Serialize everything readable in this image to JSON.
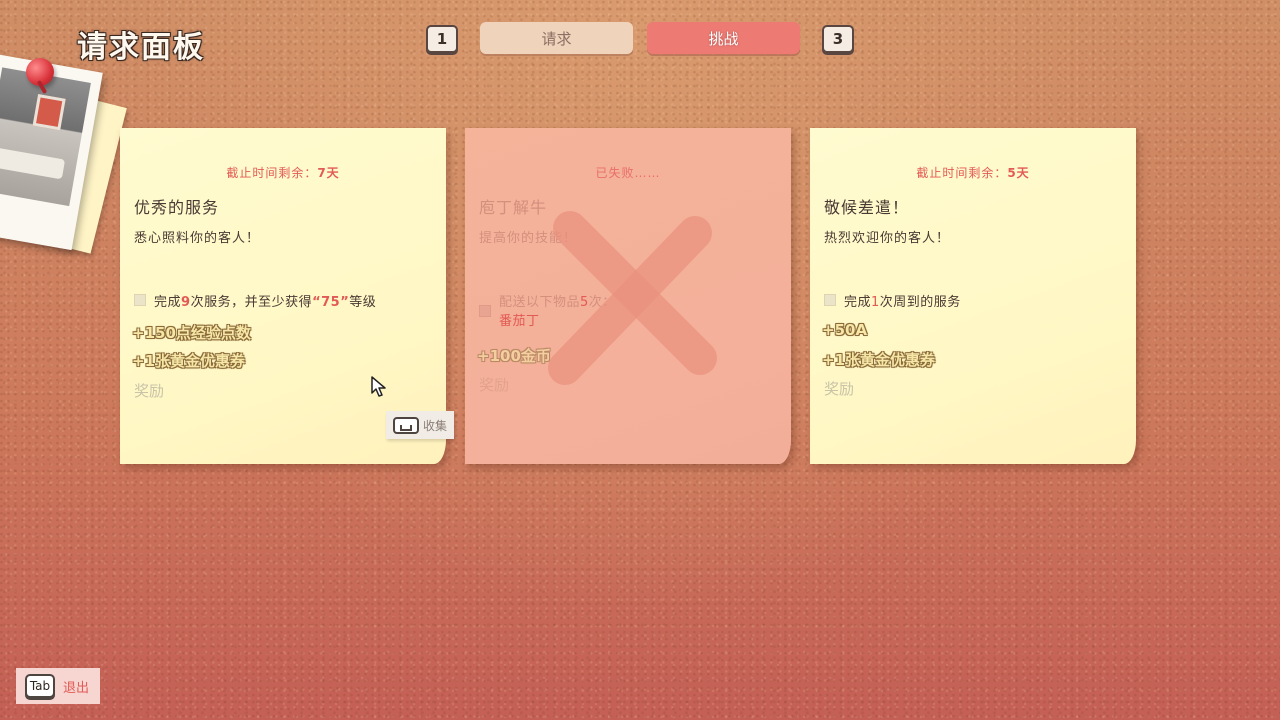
{
  "header": {
    "title": "请求面板",
    "tab_left_key": "1",
    "tab_right_key": "3",
    "tabs": [
      {
        "label": "请求",
        "active": false
      },
      {
        "label": "挑战",
        "active": true
      }
    ]
  },
  "notes": [
    {
      "deadline_prefix": "截止时间剩余：",
      "deadline_value": "7天",
      "title": "优秀的服务",
      "desc": "悉心照料你的客人！",
      "task_pre": "完成",
      "task_num": "9",
      "task_mid": "次服务，并至少获得",
      "task_grade": "“75”",
      "task_post": "等级",
      "rewards": [
        "+150点经验点数",
        "+1张黄金优惠券"
      ],
      "reward_label": "奖励",
      "status": "active"
    },
    {
      "deadline_full": "已失败……",
      "title": "庖丁解牛",
      "desc": "提高你的技能！",
      "task_pre": "配送以下物品",
      "task_num": "5",
      "task_post": "次：",
      "task_item": "番茄丁",
      "rewards": [
        "+100金币"
      ],
      "reward_label": "奖励",
      "status": "failed"
    },
    {
      "deadline_prefix": "截止时间剩余：",
      "deadline_value": "5天",
      "title": "敬候差遣！",
      "desc": "热烈欢迎你的客人！",
      "task_pre": "完成",
      "task_num": "1",
      "task_post": "次周到的服务",
      "rewards": [
        "+50A",
        "+1张黄金优惠券"
      ],
      "reward_label": "奖励",
      "status": "active"
    }
  ],
  "collect_label": "收集",
  "footer": {
    "exit_key": "Tab",
    "exit_label": "退出"
  },
  "colors": {
    "accent_red": "#e25a55",
    "active_tab": "#ee7a74",
    "note_yellow": "#fff7c4",
    "note_failed": "#f4b09a"
  }
}
